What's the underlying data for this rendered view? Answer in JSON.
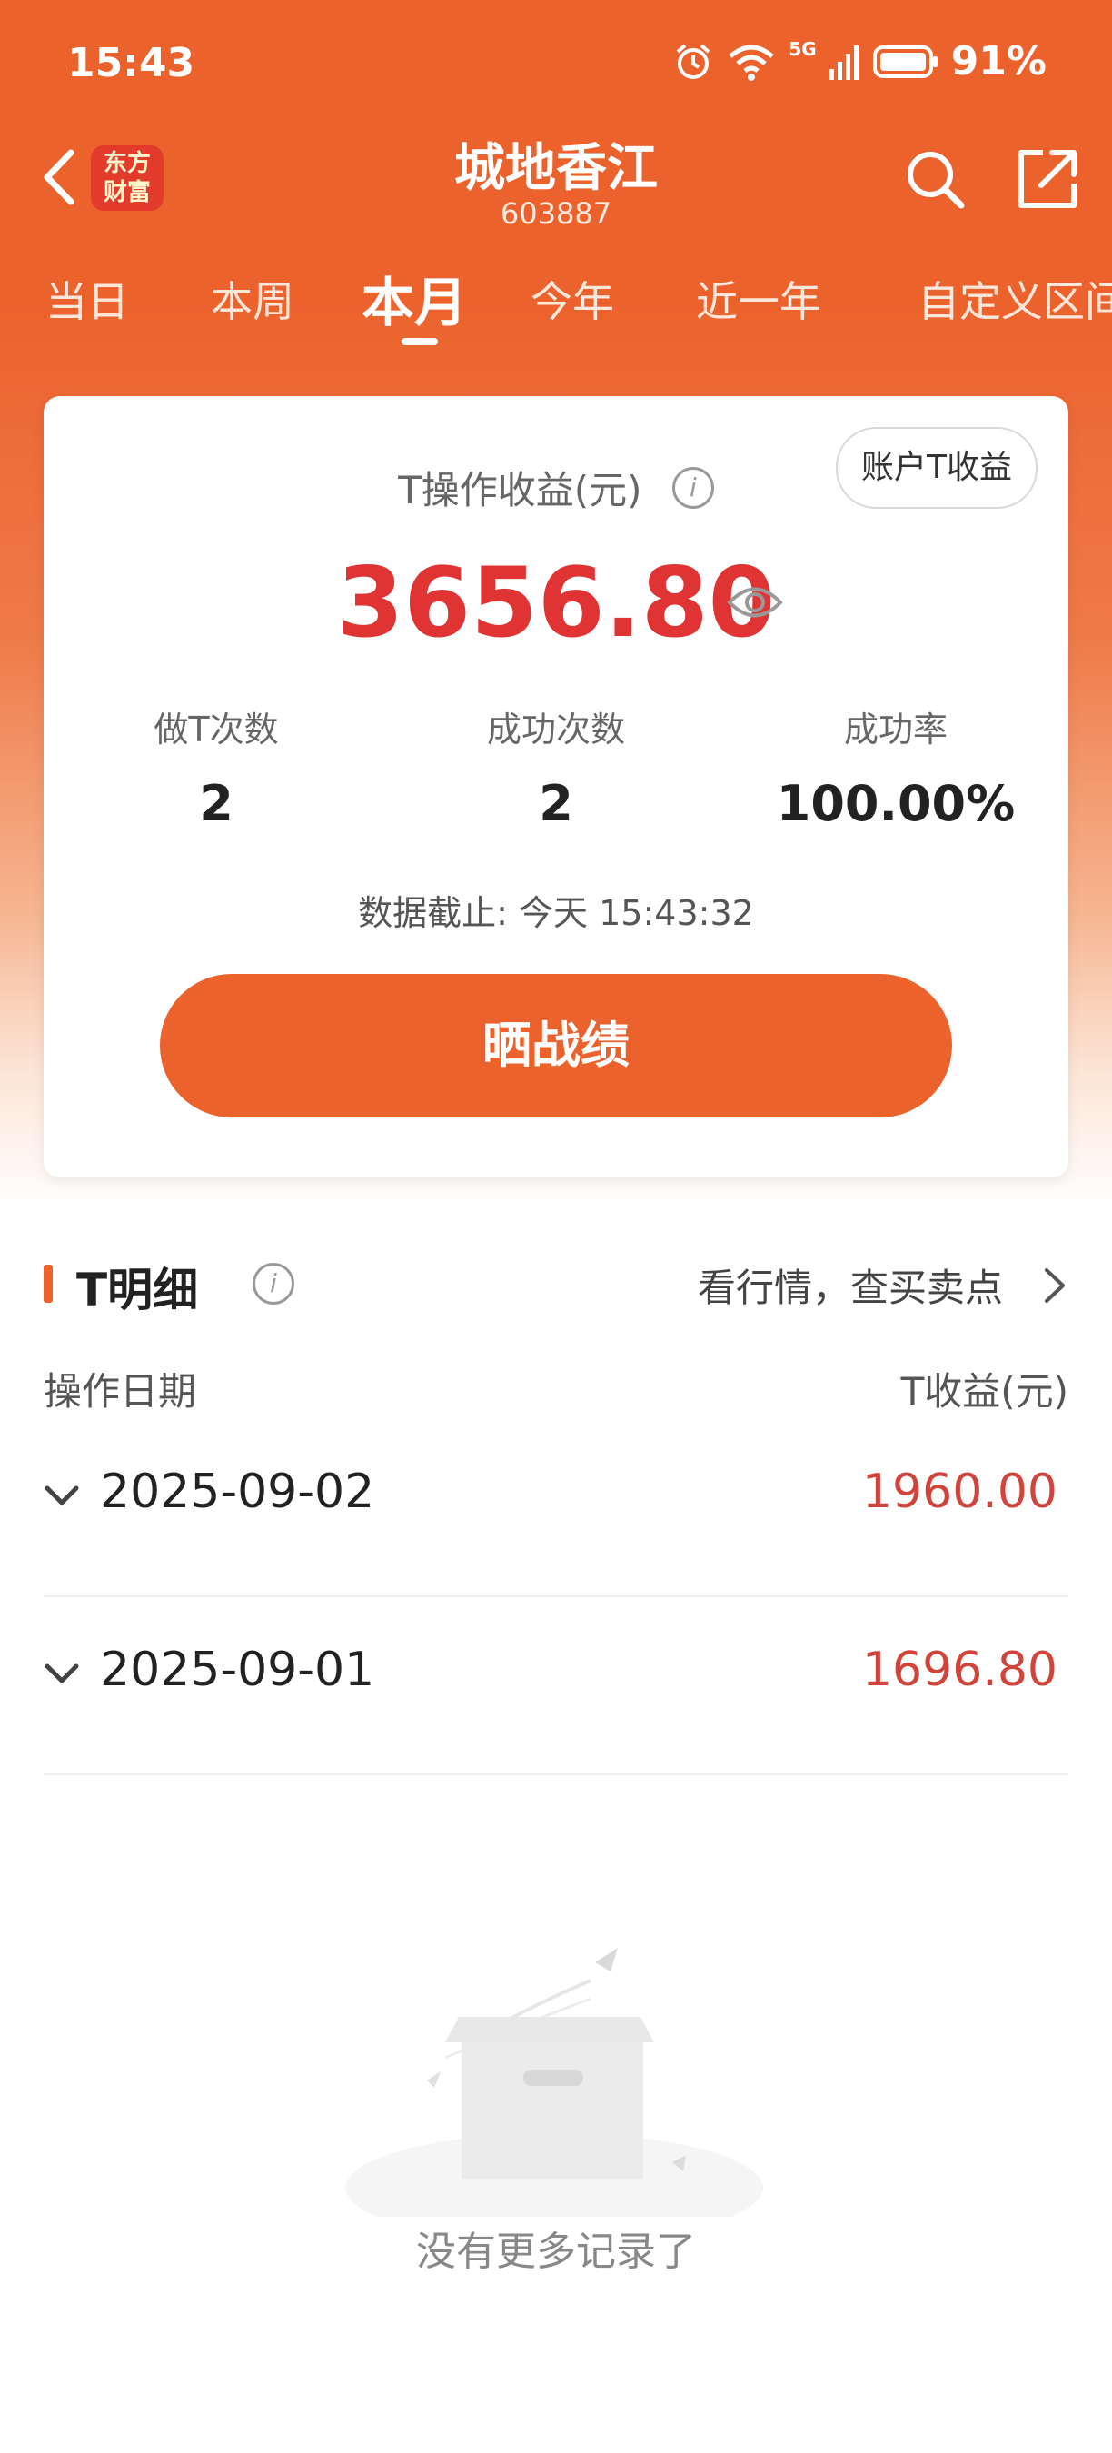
{
  "status_bar": {
    "time": "15:43",
    "network": "5G",
    "battery": "91%"
  },
  "header": {
    "logo_line1": "东方",
    "logo_line2": "财富",
    "title": "城地香江",
    "code": "603887"
  },
  "tabs": [
    {
      "label": "当日"
    },
    {
      "label": "本周"
    },
    {
      "label": "本月",
      "active": true
    },
    {
      "label": "今年"
    },
    {
      "label": "近一年"
    },
    {
      "label": "自定义区间"
    }
  ],
  "summary": {
    "account_button": "账户T收益",
    "profit_label": "T操作收益(元)",
    "profit_value": "3656.80",
    "stats": [
      {
        "label": "做T次数",
        "value": "2"
      },
      {
        "label": "成功次数",
        "value": "2"
      },
      {
        "label": "成功率",
        "value": "100.00%"
      }
    ],
    "cutoff": "数据截止: 今天 15:43:32",
    "share_button": "晒战绩"
  },
  "detail": {
    "title": "T明细",
    "link": "看行情，查买卖点",
    "col_date": "操作日期",
    "col_profit": "T收益(元)",
    "rows": [
      {
        "date": "2025-09-02",
        "profit": "1960.00"
      },
      {
        "date": "2025-09-01",
        "profit": "1696.80"
      }
    ],
    "empty_text": "没有更多记录了"
  },
  "colors": {
    "brand": "#ec622d",
    "profit_red": "#e03434"
  }
}
